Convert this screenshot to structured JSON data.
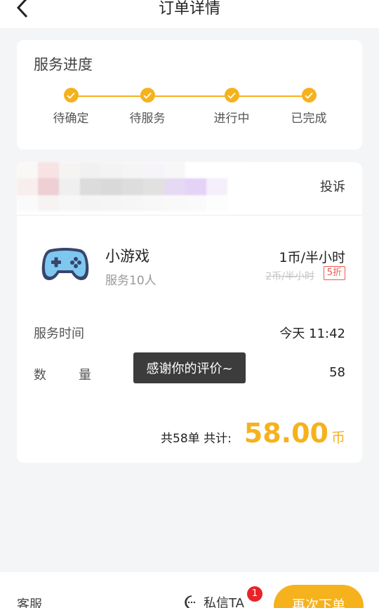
{
  "header": {
    "title": "订单详情",
    "back_icon": "chevron-left-icon"
  },
  "progress": {
    "title": "服务进度",
    "accent": "#f5b21d",
    "steps": [
      {
        "label": "待确定"
      },
      {
        "label": "待服务"
      },
      {
        "label": "进行中"
      },
      {
        "label": "已完成"
      }
    ]
  },
  "order": {
    "complain_label": "投诉",
    "item": {
      "name": "小游戏",
      "subtitle": "服务10人",
      "price": "1币/半小时",
      "original_price": "2币/半小时",
      "discount": "5折",
      "icon": "gamepad-icon"
    },
    "service_time_label": "服务时间",
    "service_time_value": "今天 11:42",
    "quantity_label_a": "数",
    "quantity_label_b": "量",
    "quantity_value": "58",
    "total_count": "共58单 共计:",
    "total_amount": "58.00",
    "currency": "币"
  },
  "toast": {
    "text": "感谢你的评价~"
  },
  "bottom": {
    "service_label": "客服",
    "message_label": "私信TA",
    "message_badge": "1",
    "reorder_label": "再次下单"
  }
}
